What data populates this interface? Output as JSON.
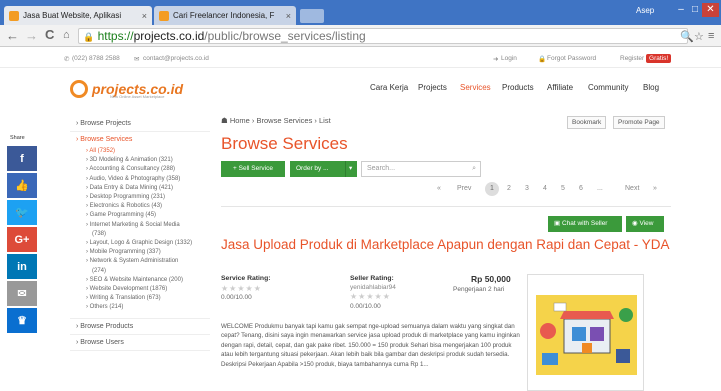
{
  "browser": {
    "tabs": [
      {
        "label": "Jasa Buat Website, Aplikasi",
        "close": "×"
      },
      {
        "label": "Cari Freelancer Indonesia, F",
        "close": "×"
      }
    ],
    "user": "Asep",
    "url_secure": "https://",
    "url_host": "projects.co.id",
    "url_path": "/public/browse_services/listing"
  },
  "topinfo": {
    "phone": "(022) 8788 2588",
    "email": "contact@projects.co.id",
    "login": "Login",
    "forgot": "Forgot Password",
    "register_prefix": "Register",
    "register_badge": "Gratis!"
  },
  "logo": {
    "word": "projects.co.id",
    "tagline": "New Online Asset Marketplace"
  },
  "nav": [
    "Cara Kerja",
    "Projects",
    "Services",
    "Products",
    "Affiliate",
    "Community",
    "Blog"
  ],
  "share": {
    "label": "Share",
    "buttons": [
      {
        "icon": "facebook-icon",
        "glyph": "f",
        "color": "#3b5998"
      },
      {
        "icon": "thumbs-up-icon",
        "glyph": "👍",
        "color": "#3b68b8"
      },
      {
        "icon": "twitter-icon",
        "glyph": "🐦",
        "color": "#1da1f2"
      },
      {
        "icon": "google-plus-icon",
        "glyph": "G+",
        "color": "#dd4b39"
      },
      {
        "icon": "linkedin-icon",
        "glyph": "in",
        "color": "#0077b5"
      },
      {
        "icon": "email-icon",
        "glyph": "✉",
        "color": "#999999"
      },
      {
        "icon": "crown-icon",
        "glyph": "♛",
        "color": "#0a6fd0"
      }
    ]
  },
  "sidebar": {
    "browse_projects": "Browse Projects",
    "browse_services": "Browse Services",
    "categories": [
      "All (7352)",
      "3D Modeling & Animation (321)",
      "Accounting & Consultancy (288)",
      "Audio, Video & Photography (358)",
      "Data Entry & Data Mining (421)",
      "Desktop Programming (231)",
      "Electronics & Robotics (43)",
      "Game Programming (45)",
      "Internet Marketing & Social Media",
      "(738)",
      "Layout, Logo & Graphic Design (1332)",
      "Mobile Programming (337)",
      "Network & System Administration",
      "(274)",
      "SEO & Website Maintenance (200)",
      "Website Development (1876)",
      "Writing & Translation (673)",
      "Others (214)"
    ],
    "browse_products": "Browse Products",
    "browse_users": "Browse Users"
  },
  "content": {
    "breadcrumb": "Home › Browse Services › List",
    "bookmark": "Bookmark",
    "promote": "Promote Page",
    "title": "Browse Services",
    "sell_service": "+ Sell Service",
    "order_by": "Order by ...",
    "order_caret": "▾",
    "search_placeholder": "Search...",
    "pager": {
      "prev": "Prev",
      "pages": [
        "1",
        "2",
        "3",
        "4",
        "5",
        "6",
        "..."
      ],
      "next": "Next",
      "first": "«",
      "last": "»"
    },
    "chat": "Chat with Seller",
    "view": "View",
    "job_title": "Jasa Upload Produk di Marketplace Apapun dengan Rapi dan Cepat - YDA",
    "service_rating_label": "Service Rating:",
    "service_rating_value": "0.00/10.00",
    "seller_rating_label": "Seller Rating:",
    "seller_name": "yenidahlabiar94",
    "seller_rating_value": "0.00/10.00",
    "price": "Rp 50,000",
    "duration": "Pengerjaan 2 hari",
    "description": "WELCOME Produkmu banyak tapi kamu gak sempat nge-upload semuanya dalam waktu yang singkat dan cepat? Tenang, disini saya ingin menawarkan service jasa upload produk di marketplace yang kamu inginkan dengan rapi, detail, cepat, dan gak pake ribet. 150.000 = 150 produk Sehari bisa mengerjakan 100 produk atau lebih tergantung situasi pekerjaan. Akan lebih baik bila gambar dan deskripsi produk sudah tersedia. Deskripsi Pekerjaan Apabila >150 produk, biaya tambahannya cuma Rp 1..."
  }
}
